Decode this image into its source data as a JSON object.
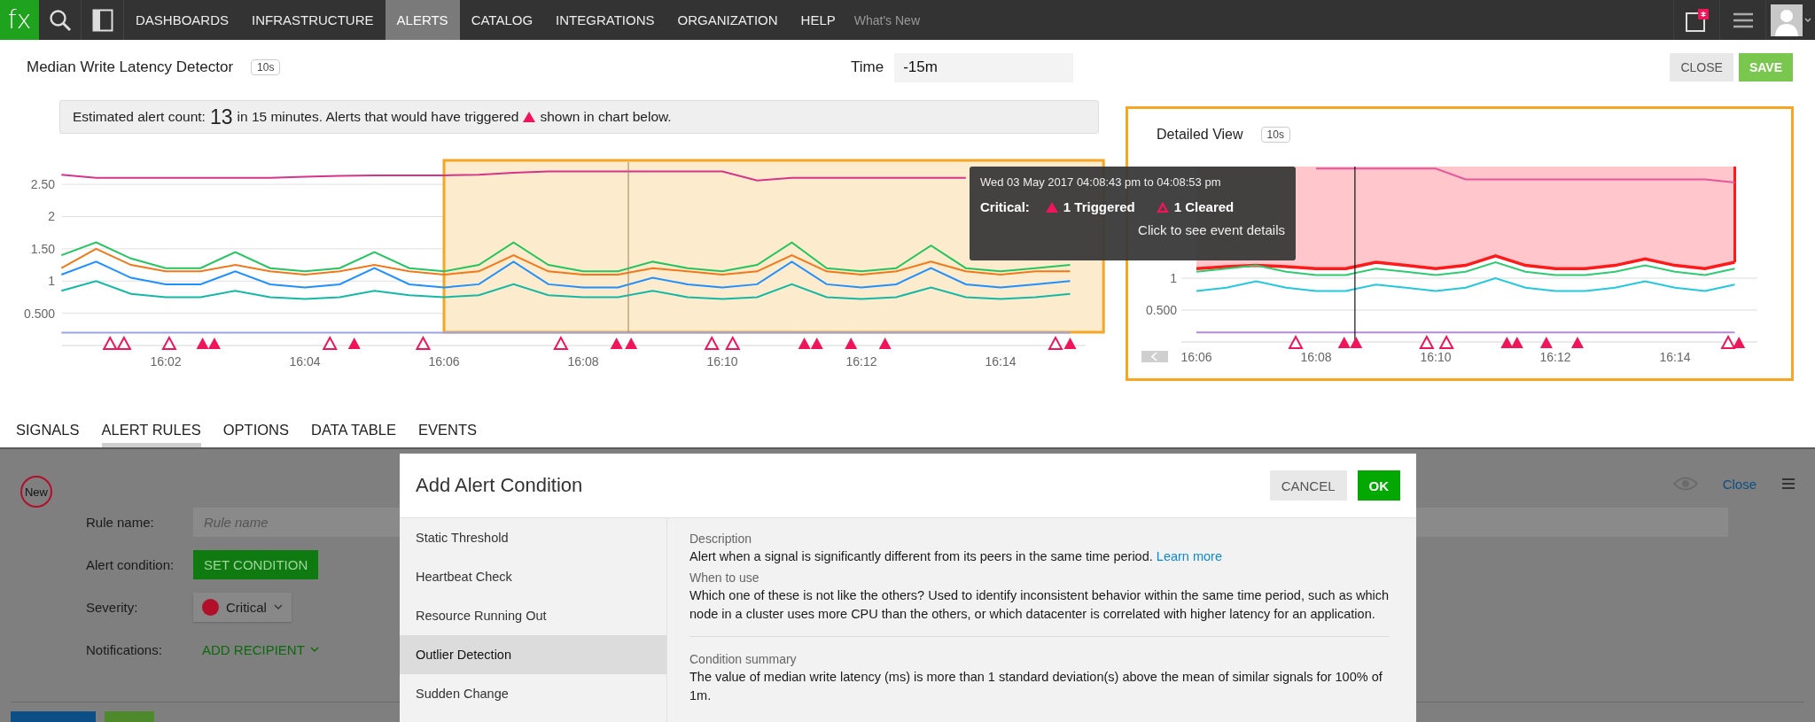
{
  "nav": {
    "logo": "fx",
    "items": [
      {
        "label": "DASHBOARDS",
        "selected": false
      },
      {
        "label": "INFRASTRUCTURE",
        "selected": false
      },
      {
        "label": "ALERTS",
        "selected": true
      },
      {
        "label": "CATALOG",
        "selected": false
      },
      {
        "label": "INTEGRATIONS",
        "selected": false
      },
      {
        "label": "ORGANIZATION",
        "selected": false
      },
      {
        "label": "HELP",
        "selected": false
      }
    ],
    "whats_new": "What's New"
  },
  "detector": {
    "title": "Median Write Latency Detector",
    "resolution": "10s",
    "time_label": "Time",
    "time_value": "-15m",
    "buttons": [
      {
        "label": "CLOSE",
        "kind": "secondary"
      },
      {
        "label": "SAVE",
        "kind": "primary"
      }
    ]
  },
  "banner": {
    "prefix": "Estimated alert count:",
    "count": "13",
    "middle": "in 15 minutes. Alerts that would have triggered",
    "suffix": "shown in chart below."
  },
  "main_chart": {
    "chart_data": {
      "type": "line",
      "grid": true,
      "ylim": [
        0,
        2.9
      ],
      "categories": [
        null,
        null,
        null,
        "16:02",
        null,
        null,
        null,
        "16:04",
        null,
        null,
        null,
        "16:06",
        null,
        null,
        null,
        "16:08",
        null,
        null,
        null,
        "16:10",
        null,
        null,
        null,
        "16:12",
        null,
        null,
        null,
        "16:14",
        null,
        null
      ],
      "yticks": [
        {
          "value": 0.5,
          "label": "0.500"
        },
        {
          "value": 1,
          "label": "1"
        },
        {
          "value": 1.5,
          "label": "1.50"
        },
        {
          "value": 2,
          "label": "2"
        },
        {
          "value": 2.5,
          "label": "2.50"
        }
      ],
      "series": [
        {
          "color": "#d6338a",
          "values": [
            2.65,
            2.6,
            2.6,
            2.6,
            2.6,
            2.6,
            2.6,
            2.62,
            2.63,
            2.64,
            2.64,
            2.64,
            2.65,
            2.68,
            2.7,
            2.7,
            2.7,
            2.7,
            2.7,
            2.7,
            2.56,
            2.6,
            2.6,
            2.6,
            2.6,
            2.6,
            2.6,
            null,
            null,
            null
          ]
        },
        {
          "color": "#22c55e",
          "values": [
            1.4,
            1.6,
            1.35,
            1.2,
            1.2,
            1.45,
            1.2,
            1.15,
            1.2,
            1.45,
            1.2,
            1.15,
            1.25,
            1.6,
            1.25,
            1.15,
            1.15,
            1.3,
            1.2,
            1.15,
            1.25,
            1.6,
            1.2,
            1.15,
            1.2,
            1.55,
            1.2,
            1.15,
            1.2,
            1.25
          ]
        },
        {
          "color": "#f07818",
          "values": [
            1.2,
            1.5,
            1.25,
            1.15,
            1.15,
            1.25,
            1.15,
            1.1,
            1.15,
            1.25,
            1.15,
            1.1,
            1.15,
            1.4,
            1.15,
            1.1,
            1.1,
            1.2,
            1.15,
            1.1,
            1.15,
            1.4,
            1.15,
            1.1,
            1.15,
            1.3,
            1.15,
            1.1,
            1.15,
            1.15
          ]
        },
        {
          "color": "#1e90ff",
          "values": [
            1.1,
            1.3,
            1.05,
            0.95,
            0.95,
            1.15,
            0.95,
            0.9,
            0.95,
            1.2,
            0.95,
            0.9,
            0.95,
            1.3,
            0.95,
            0.9,
            0.9,
            1.05,
            0.95,
            0.9,
            0.95,
            1.3,
            0.95,
            0.9,
            0.95,
            1.2,
            0.95,
            0.9,
            0.95,
            1.0
          ]
        },
        {
          "color": "#14b8a6",
          "values": [
            0.85,
            1.0,
            0.8,
            0.75,
            0.75,
            0.85,
            0.75,
            0.72,
            0.75,
            0.85,
            0.78,
            0.75,
            0.78,
            0.95,
            0.78,
            0.75,
            0.75,
            0.85,
            0.75,
            0.72,
            0.75,
            0.95,
            0.75,
            0.72,
            0.75,
            0.9,
            0.75,
            0.72,
            0.75,
            0.8
          ]
        },
        {
          "color": "#9aa4e8",
          "values": [
            0.2,
            0.2,
            0.2,
            0.2,
            0.2,
            0.2,
            0.2,
            0.2,
            0.2,
            0.2,
            0.2,
            0.2,
            0.2,
            0.2,
            0.2,
            0.2,
            0.2,
            0.2,
            0.2,
            0.2,
            0.2,
            0.2,
            0.2,
            0.2,
            0.2,
            0.2,
            0.2,
            0.2,
            0.2,
            0.2
          ]
        }
      ]
    },
    "alert_markers": [
      {
        "kind": "cleared"
      },
      {
        "kind": "cleared"
      },
      {
        "kind": "cleared"
      },
      {
        "kind": "triggered"
      },
      {
        "kind": "triggered"
      },
      {
        "kind": "cleared"
      },
      {
        "kind": "triggered"
      },
      {
        "kind": "cleared"
      },
      {
        "kind": "cleared"
      },
      {
        "kind": "triggered"
      },
      {
        "kind": "triggered"
      },
      {
        "kind": "cleared"
      },
      {
        "kind": "cleared"
      },
      {
        "kind": "triggered"
      },
      {
        "kind": "triggered"
      },
      {
        "kind": "triggered"
      },
      {
        "kind": "triggered"
      },
      {
        "kind": "cleared"
      },
      {
        "kind": "triggered"
      }
    ]
  },
  "detailed_view": {
    "title": "Detailed View",
    "resolution": "10s",
    "chart_data": {
      "type": "line",
      "grid": true,
      "ylim": [
        0,
        2.75
      ],
      "categories": [
        "16:06",
        null,
        null,
        null,
        "16:08",
        null,
        null,
        null,
        "16:10",
        null,
        null,
        null,
        "16:12",
        null,
        null,
        null,
        "16:14",
        null,
        null
      ],
      "yticks": [
        {
          "value": 0.5,
          "label": "0.500"
        },
        {
          "value": 1,
          "label": "1"
        }
      ],
      "series": [
        {
          "color": "#e8559a",
          "values": [
            null,
            null,
            null,
            null,
            2.72,
            2.72,
            2.72,
            2.72,
            2.72,
            2.55,
            2.55,
            2.55,
            2.55,
            2.55,
            2.55,
            2.55,
            2.55,
            2.55,
            2.5
          ]
        },
        {
          "color": "#ff1a1a",
          "values": [
            1.15,
            1.18,
            1.2,
            1.18,
            1.15,
            1.15,
            1.25,
            1.2,
            1.15,
            1.2,
            1.35,
            1.2,
            1.15,
            1.15,
            1.2,
            1.3,
            1.2,
            1.15,
            1.25
          ]
        },
        {
          "color": "#2ecc71",
          "values": [
            1.1,
            1.15,
            1.2,
            1.1,
            1.05,
            1.05,
            1.15,
            1.1,
            1.05,
            1.1,
            1.25,
            1.1,
            1.05,
            1.05,
            1.1,
            1.2,
            1.1,
            1.05,
            1.15
          ]
        },
        {
          "color": "#22c7e0",
          "values": [
            0.8,
            0.85,
            0.95,
            0.85,
            0.8,
            0.8,
            0.9,
            0.85,
            0.8,
            0.85,
            1.0,
            0.85,
            0.8,
            0.8,
            0.85,
            0.95,
            0.85,
            0.8,
            0.9
          ]
        },
        {
          "color": "#b48ad8",
          "values": [
            0.15,
            0.15,
            0.15,
            0.15,
            0.15,
            0.15,
            0.15,
            0.15,
            0.15,
            0.15,
            0.15,
            0.15,
            0.15,
            0.15,
            0.15,
            0.15,
            0.15,
            0.15,
            0.15
          ]
        }
      ]
    },
    "alert_markers": [
      {
        "kind": "cleared"
      },
      {
        "kind": "triggered"
      },
      {
        "kind": "triggered"
      },
      {
        "kind": "cleared"
      },
      {
        "kind": "cleared"
      },
      {
        "kind": "triggered"
      },
      {
        "kind": "triggered"
      },
      {
        "kind": "triggered"
      },
      {
        "kind": "triggered"
      },
      {
        "kind": "cleared"
      },
      {
        "kind": "triggered"
      }
    ]
  },
  "tooltip": {
    "time_range": "Wed 03 May 2017 04:08:43 pm to 04:08:53 pm",
    "severity": "Critical:",
    "triggered": "1 Triggered",
    "cleared": "1 Cleared",
    "hint": "Click to see event details"
  },
  "tabs": [
    {
      "label": "SIGNALS",
      "selected": false
    },
    {
      "label": "ALERT RULES",
      "selected": true
    },
    {
      "label": "OPTIONS",
      "selected": false
    },
    {
      "label": "DATA TABLE",
      "selected": false
    },
    {
      "label": "EVENTS",
      "selected": false
    }
  ],
  "rule_editor": {
    "badge": "New",
    "close": "Close",
    "fields": [
      {
        "kind": "text",
        "label": "Rule name:",
        "placeholder": "Rule name"
      },
      {
        "kind": "button",
        "label": "Alert condition:",
        "value": "SET CONDITION"
      },
      {
        "kind": "select",
        "label": "Severity:",
        "value": "Critical",
        "color": "#b0102a"
      },
      {
        "kind": "link",
        "label": "Notifications:",
        "value": "ADD RECIPIENT"
      }
    ]
  },
  "modal": {
    "title": "Add Alert Condition",
    "buttons": [
      {
        "label": "CANCEL",
        "kind": "secondary"
      },
      {
        "label": "OK",
        "kind": "primary"
      }
    ],
    "types": [
      {
        "label": "Static Threshold",
        "selected": false
      },
      {
        "label": "Heartbeat Check",
        "selected": false
      },
      {
        "label": "Resource Running Out",
        "selected": false
      },
      {
        "label": "Outlier Detection",
        "selected": true
      },
      {
        "label": "Sudden Change",
        "selected": false
      }
    ],
    "sections": [
      {
        "heading": "Description",
        "text": "Alert when a signal is significantly different from its peers in the same time period.",
        "link": "Learn more"
      },
      {
        "heading": "When to use",
        "text": "Which one of these is not like the others? Used to identify inconsistent behavior within the same time period, such as which node in a cluster uses more CPU than the others, or which datacenter is correlated with higher latency for an application."
      },
      {
        "heading": "Condition summary",
        "text": "The value of median write latency (ms) is more than 1 standard deviation(s) above the mean of similar signals for 100% of 1m."
      }
    ]
  }
}
